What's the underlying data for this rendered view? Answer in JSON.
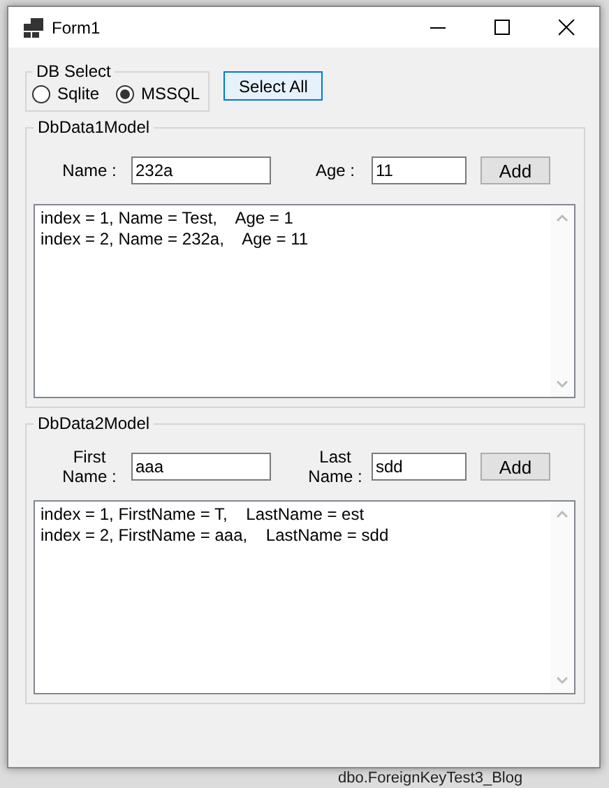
{
  "window": {
    "title": "Form1"
  },
  "db_select": {
    "label": "DB Select",
    "options": [
      {
        "label": "Sqlite",
        "selected": false
      },
      {
        "label": "MSSQL",
        "selected": true
      }
    ]
  },
  "select_all_button": {
    "label": "Select All",
    "focused": true
  },
  "groups": [
    {
      "title": "DbData1Model",
      "fields": [
        {
          "label": "Name :",
          "value": "232a"
        },
        {
          "label": "Age :",
          "value": "11"
        }
      ],
      "add_button": "Add",
      "lines": [
        "index = 1, Name = Test,    Age = 1",
        "index = 2, Name = 232a,    Age = 11"
      ]
    },
    {
      "title": "DbData2Model",
      "fields": [
        {
          "label": "First Name :",
          "value": "aaa"
        },
        {
          "label": "Last Name :",
          "value": "sdd"
        }
      ],
      "add_button": "Add",
      "lines": [
        "index = 1, FirstName = T,    LastName = est",
        "index = 2, FirstName = aaa,    LastName = sdd"
      ]
    }
  ],
  "background_item": "dbo.ForeignKeyTest3_Blog"
}
